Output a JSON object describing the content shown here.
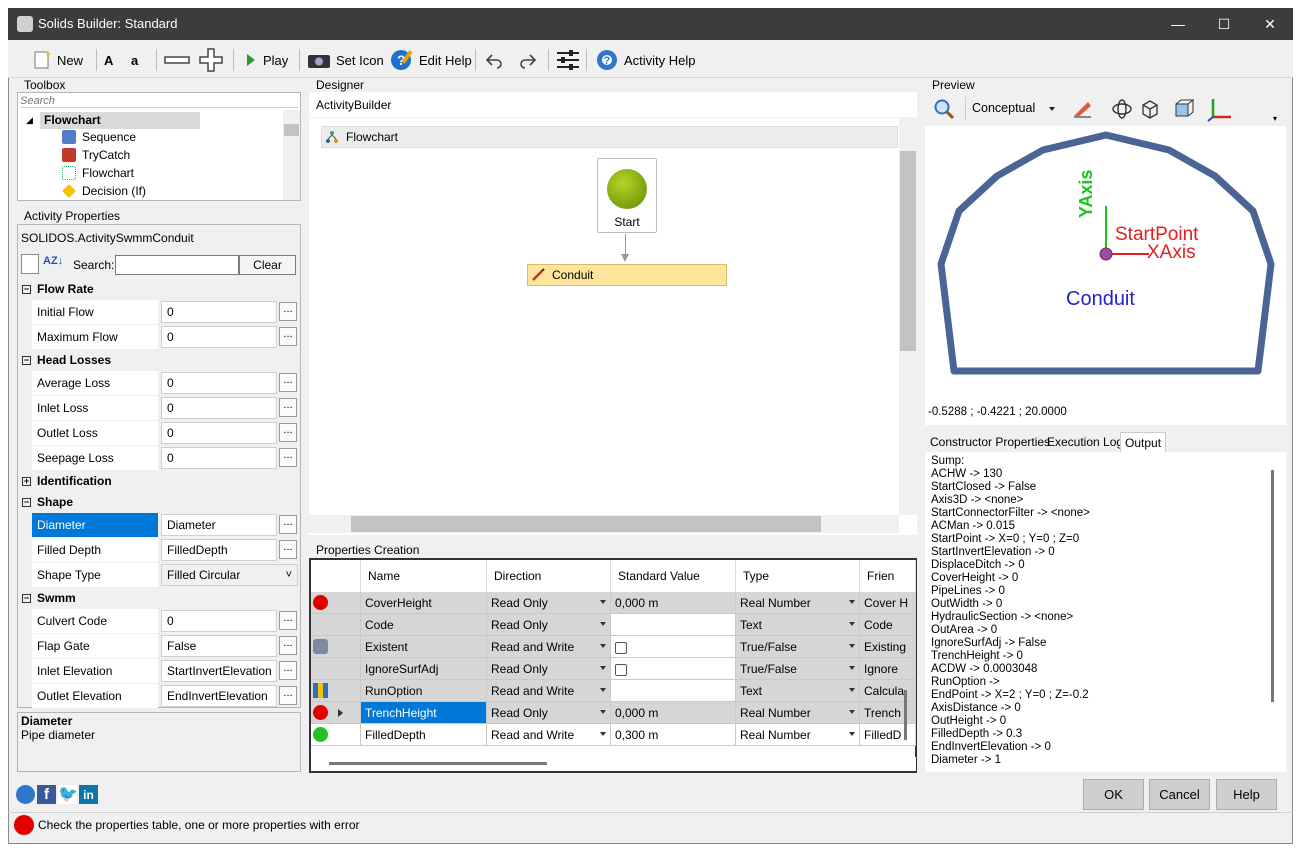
{
  "window": {
    "title": "Solids Builder: Standard"
  },
  "toolbar": {
    "new": "New",
    "bold_a": "A",
    "small_a": "a",
    "play": "Play",
    "set_icon": "Set Icon",
    "edit_help": "Edit Help",
    "activity_help": "Activity Help"
  },
  "toolbox": {
    "title": "Toolbox",
    "search_placeholder": "Search",
    "group": "Flowchart",
    "items": [
      "Sequence",
      "TryCatch",
      "Flowchart",
      "Decision (If)"
    ]
  },
  "activity_properties": {
    "title": "Activity Properties",
    "class_name": "SOLIDOS.ActivitySwmmConduit",
    "search_label": "Search:",
    "clear": "Clear",
    "categories": [
      {
        "name": "Flow Rate",
        "expanded": true,
        "rows": [
          {
            "name": "Initial Flow",
            "value": "0"
          },
          {
            "name": "Maximum Flow",
            "value": "0"
          }
        ]
      },
      {
        "name": "Head Losses",
        "expanded": true,
        "rows": [
          {
            "name": "Average Loss",
            "value": "0"
          },
          {
            "name": "Inlet Loss",
            "value": "0"
          },
          {
            "name": "Outlet Loss",
            "value": "0"
          },
          {
            "name": "Seepage Loss",
            "value": "0"
          }
        ]
      },
      {
        "name": "Identification",
        "expanded": false,
        "rows": []
      },
      {
        "name": "Shape",
        "expanded": true,
        "rows": [
          {
            "name": "Diameter",
            "value": "Diameter"
          },
          {
            "name": "Filled Depth",
            "value": "FilledDepth"
          },
          {
            "name": "Shape Type",
            "value": "Filled Circular"
          }
        ]
      },
      {
        "name": "Swmm",
        "expanded": true,
        "rows": [
          {
            "name": "Culvert Code",
            "value": "0"
          },
          {
            "name": "Flap Gate",
            "value": "False"
          },
          {
            "name": "Inlet Elevation",
            "value": "StartInvertElevation"
          },
          {
            "name": "Outlet Elevation",
            "value": "EndInvertElevation"
          }
        ]
      }
    ],
    "help_title": "Diameter",
    "help_text": "Pipe diameter"
  },
  "designer": {
    "title": "Designer",
    "breadcrumb": "ActivityBuilder",
    "flowchart": "Flowchart",
    "start": "Start",
    "conduit": "Conduit"
  },
  "properties_creation": {
    "title": "Properties Creation",
    "columns": [
      "Name",
      "Direction",
      "Standard Value",
      "Type",
      "Frien"
    ],
    "rows": [
      {
        "status": "#e00000",
        "name": "CoverHeight",
        "direction": "Read Only",
        "value": "0,000 m",
        "type": "Real Number",
        "friendly": "Cover H"
      },
      {
        "status": "",
        "name": "Code",
        "direction": "Read Only",
        "value": "",
        "type": "Text",
        "friendly": "Code"
      },
      {
        "status": "gear",
        "name": "Existent",
        "direction": "Read and Write",
        "value": "checkbox",
        "type": "True/False",
        "friendly": "Existing"
      },
      {
        "status": "",
        "name": "IgnoreSurfAdj",
        "direction": "Read Only",
        "value": "checkbox",
        "type": "True/False",
        "friendly": "Ignore"
      },
      {
        "status": "chart",
        "name": "RunOption",
        "direction": "Read and Write",
        "value": "",
        "type": "Text",
        "friendly": "Calcula"
      },
      {
        "status": "#e00000",
        "name": "TrenchHeight",
        "direction": "Read Only",
        "value": "0,000 m",
        "type": "Real Number",
        "friendly": "Trench"
      },
      {
        "status": "#22c022",
        "name": "FilledDepth",
        "direction": "Read and Write",
        "value": "0,300 m",
        "type": "Real Number",
        "friendly": "FilledD"
      }
    ]
  },
  "preview": {
    "title": "Preview",
    "view_mode": "Conceptual",
    "label_y": "YAxis",
    "label_start": "StartPoint",
    "label_x": "XAxis",
    "label_conduit": "Conduit",
    "coords": "-0.5288 ; -0.4221 ; 20.0000"
  },
  "output": {
    "tabs": [
      "Constructor Properties",
      "Execution Log",
      "Output"
    ],
    "lines": [
      "Sump:",
      "ACHW -> 130",
      "StartClosed -> False",
      "Axis3D -> <none>",
      "StartConnectorFilter -> <none>",
      "ACMan -> 0.015",
      "StartPoint -> X=0 ; Y=0 ; Z=0",
      "StartInvertElevation -> 0",
      "DisplaceDitch -> 0",
      "CoverHeight -> 0",
      "PipeLines -> 0",
      "OutWidth -> 0",
      "HydraulicSection -> <none>",
      "OutArea -> 0",
      "IgnoreSurfAdj -> False",
      "TrenchHeight -> 0",
      "ACDW -> 0.0003048",
      "RunOption ->",
      "EndPoint -> X=2 ; Y=0 ; Z=-0.2",
      "AxisDistance -> 0",
      "OutHeight -> 0",
      "FilledDepth -> 0.3",
      "EndInvertElevation -> 0",
      "Diameter -> 1"
    ]
  },
  "buttons": {
    "ok": "OK",
    "cancel": "Cancel",
    "help": "Help"
  },
  "status": {
    "message": "Check the properties table, one or more properties with error"
  },
  "colors": {
    "error": "#e00000",
    "ok": "#22c022",
    "selection": "#0078d7",
    "conduit_ring": "#4a6494"
  }
}
